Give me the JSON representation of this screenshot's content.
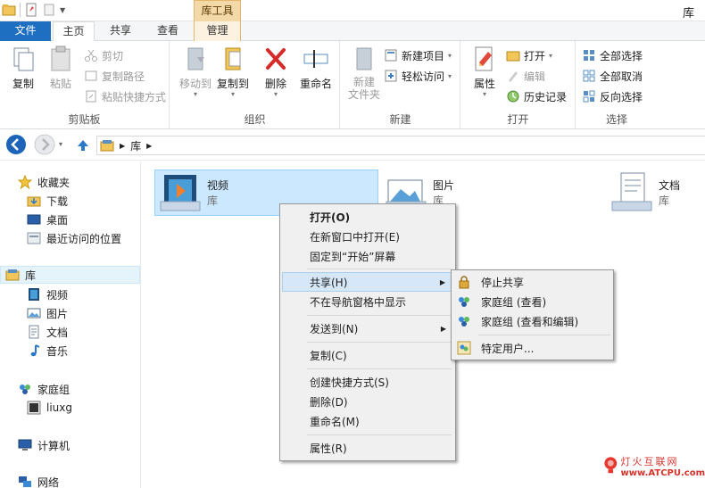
{
  "window": {
    "title": "库",
    "context_tab_group": "库工具"
  },
  "tabs": {
    "file": "文件",
    "home": "主页",
    "share": "共享",
    "view": "查看",
    "manage": "管理"
  },
  "ribbon": {
    "clipboard": {
      "label": "剪贴板",
      "copy": "复制",
      "paste": "粘贴",
      "cut": "剪切",
      "copy_path": "复制路径",
      "paste_shortcut": "粘贴快捷方式"
    },
    "organize": {
      "label": "组织",
      "move_to": "移动到",
      "copy_to": "复制到",
      "delete": "删除",
      "rename": "重命名"
    },
    "new": {
      "label": "新建",
      "new_folder": "新建\n文件夹",
      "new_item": "新建项目",
      "easy_access": "轻松访问"
    },
    "open": {
      "label": "打开",
      "properties": "属性",
      "open": "打开",
      "edit": "编辑",
      "history": "历史记录"
    },
    "select": {
      "label": "选择",
      "select_all": "全部选择",
      "select_none": "全部取消",
      "invert": "反向选择"
    }
  },
  "address": {
    "path_segment": "库"
  },
  "navpane": {
    "favorites": "收藏夹",
    "downloads": "下载",
    "desktop": "桌面",
    "recent": "最近访问的位置",
    "libraries": "库",
    "videos": "视频",
    "pictures": "图片",
    "documents": "文档",
    "music": "音乐",
    "homegroup": "家庭组",
    "user": "liuxg",
    "computer": "计算机",
    "network": "网络"
  },
  "content": {
    "items": [
      {
        "name": "视频",
        "type": "库"
      },
      {
        "name": "图片",
        "type": "库"
      },
      {
        "name": "文档",
        "type": "库"
      }
    ]
  },
  "context_menu": {
    "open": "打开(O)",
    "open_new_window": "在新窗口中打开(E)",
    "pin_start": "固定到“开始”屏幕",
    "share": "共享(H)",
    "hide_nav": "不在导航窗格中显示",
    "send_to": "发送到(N)",
    "copy": "复制(C)",
    "create_shortcut": "创建快捷方式(S)",
    "delete": "删除(D)",
    "rename": "重命名(M)",
    "properties": "属性(R)"
  },
  "share_submenu": {
    "stop_sharing": "停止共享",
    "homegroup_view": "家庭组 (查看)",
    "homegroup_view_edit": "家庭组 (查看和编辑)",
    "specific_people": "特定用户..."
  },
  "watermark": {
    "line1": "灯火互联网",
    "line2": "www.ATCPU.com"
  },
  "colors": {
    "file_tab": "#1e6fc1",
    "selection": "#cce8ff",
    "menu_bg": "#f0f0f0",
    "context_tab": "#f3d8a8"
  }
}
